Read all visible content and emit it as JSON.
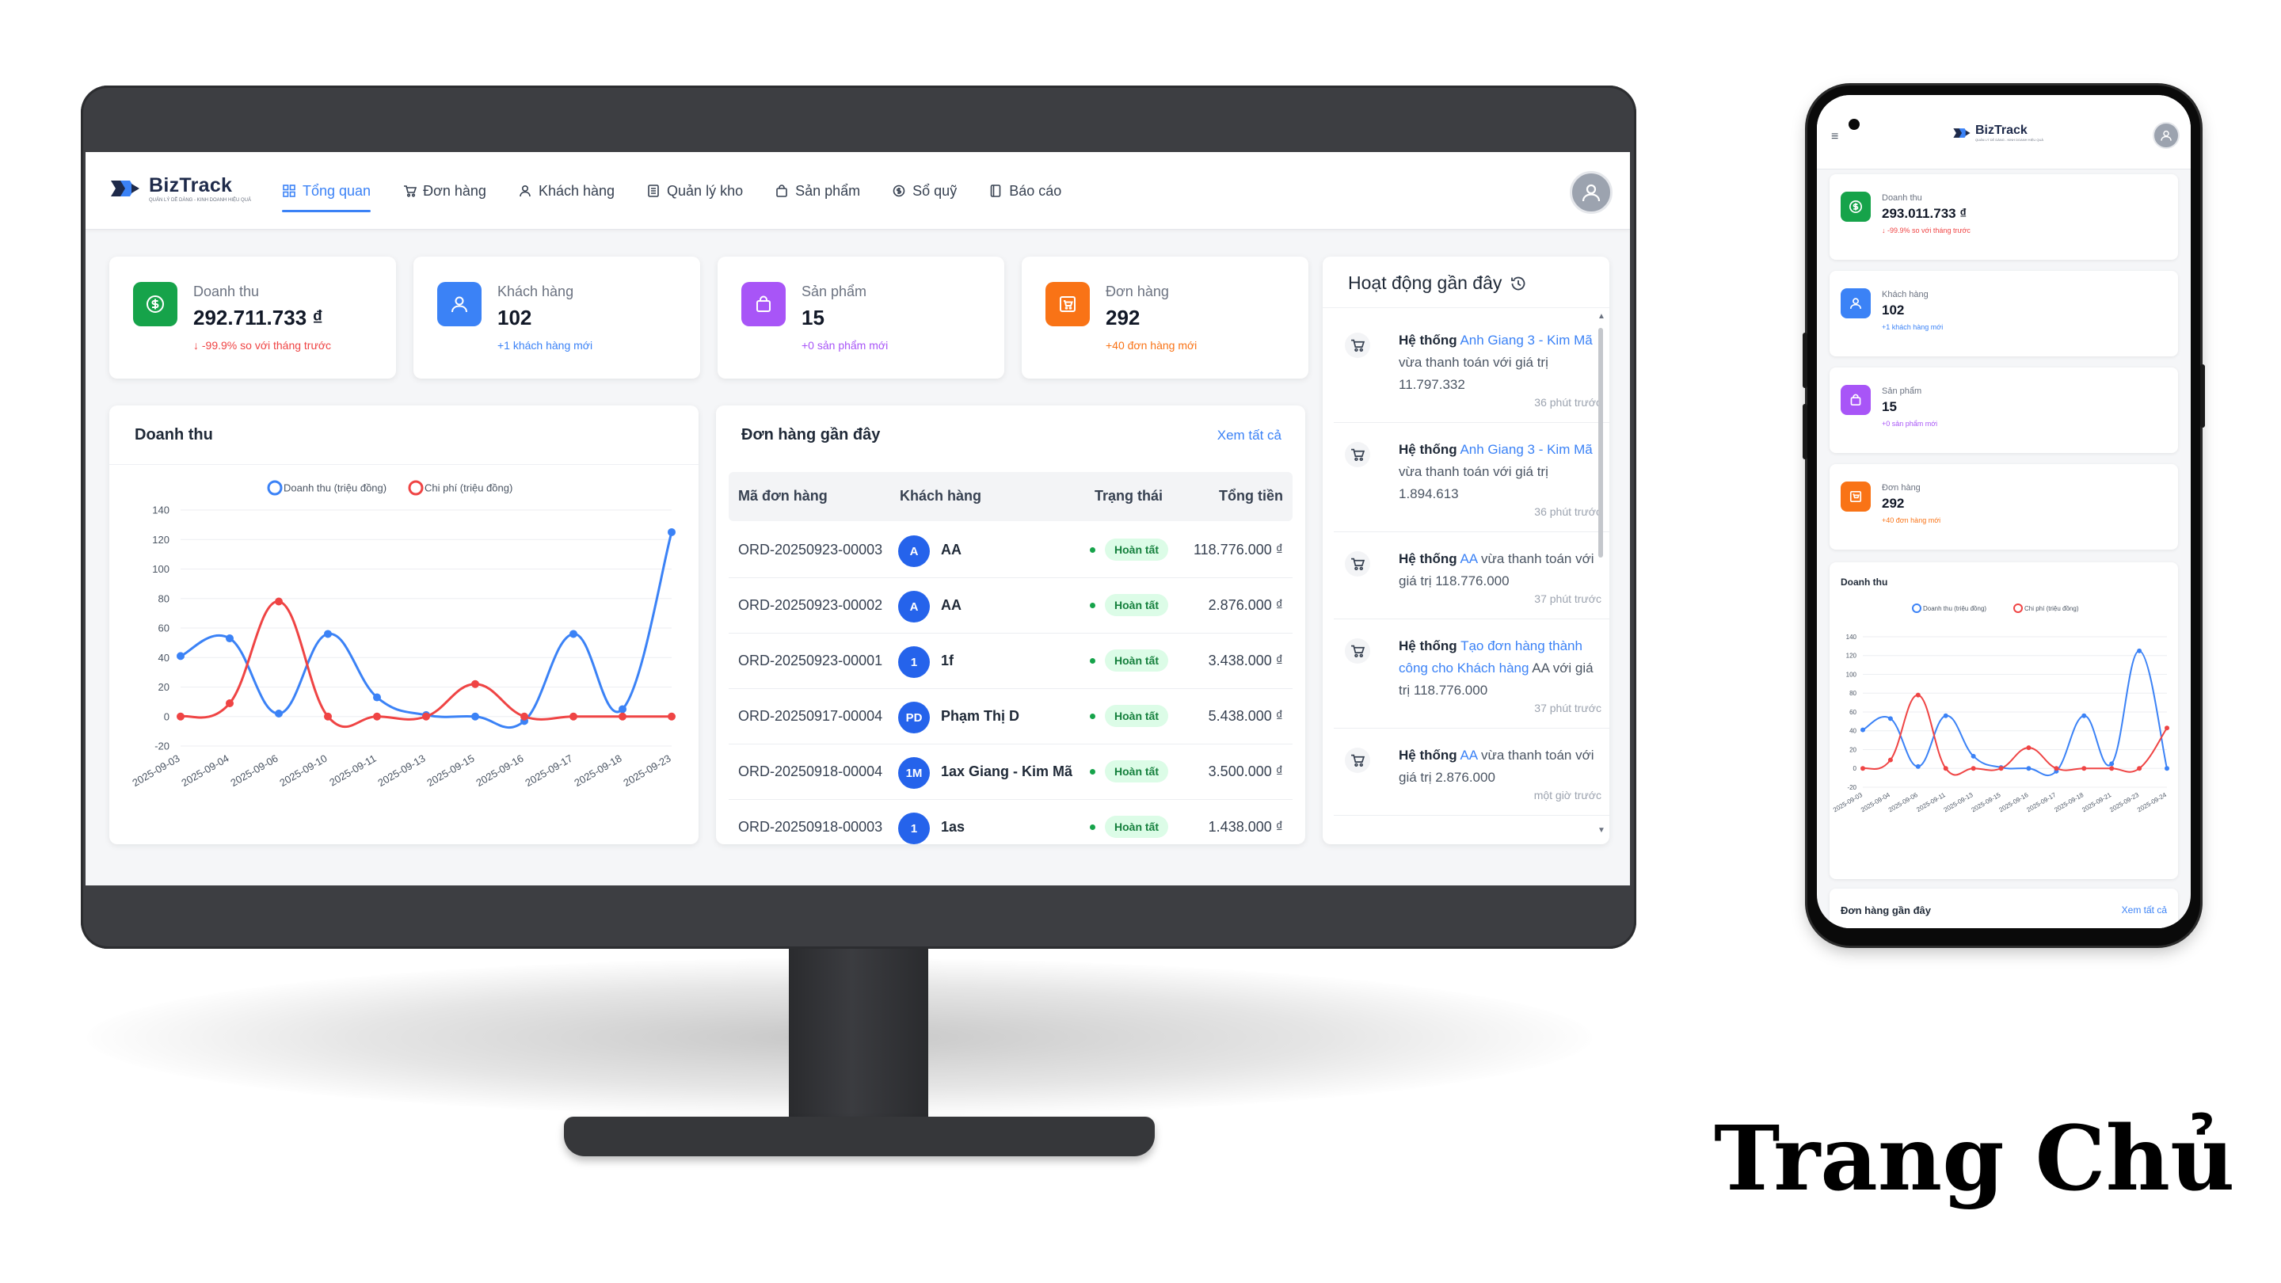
{
  "caption": "Trang Chủ",
  "brand": {
    "name": "BizTrack",
    "tagline": "QUẢN LÝ DỄ DÀNG - KINH DOANH HIỆU QUẢ",
    "blue": "#3b82f6",
    "navy": "#1e2a4a"
  },
  "nav": {
    "items": [
      {
        "label": "Tổng quan",
        "icon": "grid-icon",
        "active": true
      },
      {
        "label": "Đơn hàng",
        "icon": "cart-icon"
      },
      {
        "label": "Khách hàng",
        "icon": "user-icon"
      },
      {
        "label": "Quản lý kho",
        "icon": "box-list-icon"
      },
      {
        "label": "Sản phẩm",
        "icon": "bag-icon"
      },
      {
        "label": "Sổ quỹ",
        "icon": "coin-icon"
      },
      {
        "label": "Báo cáo",
        "icon": "report-icon"
      }
    ]
  },
  "stats": [
    {
      "label": "Doanh thu",
      "value": "292.711.733 ₫",
      "note": "↓ -99.9% so với tháng trước",
      "icon": "dollar-icon",
      "color": "#16a34a",
      "note_color": "#ef4444"
    },
    {
      "label": "Khách hàng",
      "value": "102",
      "note": "+1 khách hàng mới",
      "icon": "user-icon",
      "color": "#3b82f6",
      "note_color": "#3b82f6"
    },
    {
      "label": "Sản phẩm",
      "value": "15",
      "note": "+0 sản phẩm mới",
      "icon": "bag-icon",
      "color": "#a855f7",
      "note_color": "#a855f7"
    },
    {
      "label": "Đơn hàng",
      "value": "292",
      "note": "+40 đơn hàng mới",
      "icon": "cart-icon",
      "color": "#f97316",
      "note_color": "#f97316"
    }
  ],
  "revenue_card": {
    "title": "Doanh thu"
  },
  "chart_data": {
    "type": "line",
    "x": [
      "2025-09-03",
      "2025-09-04",
      "2025-09-06",
      "2025-09-10",
      "2025-09-11",
      "2025-09-13",
      "2025-09-15",
      "2025-09-16",
      "2025-09-17",
      "2025-09-18",
      "2025-09-23"
    ],
    "series": [
      {
        "name": "Doanh thu (triệu đồng)",
        "color": "#3b82f6",
        "values": [
          41,
          53,
          2,
          56,
          13,
          1,
          0,
          -3,
          56,
          5,
          125
        ]
      },
      {
        "name": "Chi phí (triệu đồng)",
        "color": "#ef4444",
        "values": [
          0,
          9,
          78,
          0,
          0,
          0,
          22,
          0,
          0,
          0,
          0
        ]
      }
    ],
    "ylim": [
      -20,
      140
    ],
    "yticks": [
      -20,
      0,
      20,
      40,
      60,
      80,
      100,
      120,
      140
    ],
    "grid": true,
    "legend": "top"
  },
  "orders": {
    "title": "Đơn hàng gần đây",
    "view_all": "Xem tất cả",
    "columns": [
      "Mã đơn hàng",
      "Khách hàng",
      "Trạng thái",
      "Tổng tiền"
    ],
    "rows": [
      {
        "id": "ORD-20250923-00003",
        "avatar": "A",
        "customer": "AA",
        "status": "Hoàn tất",
        "total": "118.776.000 ₫"
      },
      {
        "id": "ORD-20250923-00002",
        "avatar": "A",
        "customer": "AA",
        "status": "Hoàn tất",
        "total": "2.876.000 ₫"
      },
      {
        "id": "ORD-20250923-00001",
        "avatar": "1",
        "customer": "1f",
        "status": "Hoàn tất",
        "total": "3.438.000 ₫"
      },
      {
        "id": "ORD-20250917-00004",
        "avatar": "PD",
        "customer": "Phạm Thị D",
        "status": "Hoàn tất",
        "total": "5.438.000 ₫"
      },
      {
        "id": "ORD-20250918-00004",
        "avatar": "1M",
        "customer": "1ax Giang - Kim Mã",
        "status": "Hoàn tất",
        "total": "3.500.000 ₫"
      },
      {
        "id": "ORD-20250918-00003",
        "avatar": "1",
        "customer": "1as",
        "status": "Hoàn tất",
        "total": "1.438.000 ₫"
      }
    ]
  },
  "activity": {
    "title": "Hoạt động gần đây",
    "items": [
      {
        "actor": "Hệ thống",
        "link": "Anh Giang 3 - Kim Mã",
        "text": "vừa thanh toán với giá trị 11.797.332",
        "time": "36 phút trước"
      },
      {
        "actor": "Hệ thống",
        "link": "Anh Giang 3 - Kim Mã",
        "text": "vừa thanh toán với giá trị 1.894.613",
        "time": "36 phút trước"
      },
      {
        "actor": "Hệ thống",
        "link": "AA",
        "text": "vừa thanh toán với giá trị 118.776.000",
        "time": "37 phút trước"
      },
      {
        "actor": "Hệ thống",
        "link": "Tạo đơn hàng thành công cho Khách hàng",
        "text": "AA với giá trị 118.776.000",
        "time": "37 phút trước"
      },
      {
        "actor": "Hệ thống",
        "link": "AA",
        "text": "vừa thanh toán với giá trị 2.876.000",
        "time": "một giờ trước"
      }
    ]
  },
  "mobile": {
    "stats": [
      {
        "label": "Doanh thu",
        "value": "293.011.733 ₫",
        "note": "↓ -99.9% so với tháng trước"
      },
      {
        "label": "Khách hàng",
        "value": "102",
        "note": "+1 khách hàng mới"
      },
      {
        "label": "Sản phẩm",
        "value": "15",
        "note": "+0 sản phẩm mới"
      },
      {
        "label": "Đơn hàng",
        "value": "292",
        "note": "+40 đơn hàng mới"
      }
    ],
    "chart_title": "Doanh thu",
    "chart_data": {
      "type": "line",
      "x": [
        "2025-09-03",
        "2025-09-04",
        "2025-09-06",
        "2025-09-11",
        "2025-09-13",
        "2025-09-15",
        "2025-09-16",
        "2025-09-17",
        "2025-09-18",
        "2025-09-21",
        "2025-09-23",
        "2025-09-24"
      ],
      "series": [
        {
          "name": "Doanh thu (triệu đồng)",
          "color": "#3b82f6",
          "values": [
            41,
            53,
            2,
            56,
            13,
            1,
            0,
            -3,
            56,
            5,
            125,
            0
          ]
        },
        {
          "name": "Chi phí (triệu đồng)",
          "color": "#ef4444",
          "values": [
            0,
            9,
            78,
            0,
            0,
            0,
            22,
            0,
            0,
            0,
            0,
            43
          ]
        }
      ],
      "ylim": [
        -20,
        140
      ],
      "yticks": [
        -20,
        0,
        20,
        40,
        60,
        80,
        100,
        120,
        140
      ]
    },
    "orders_title": "Đơn hàng gần đây",
    "view_all": "Xem tất cả"
  }
}
